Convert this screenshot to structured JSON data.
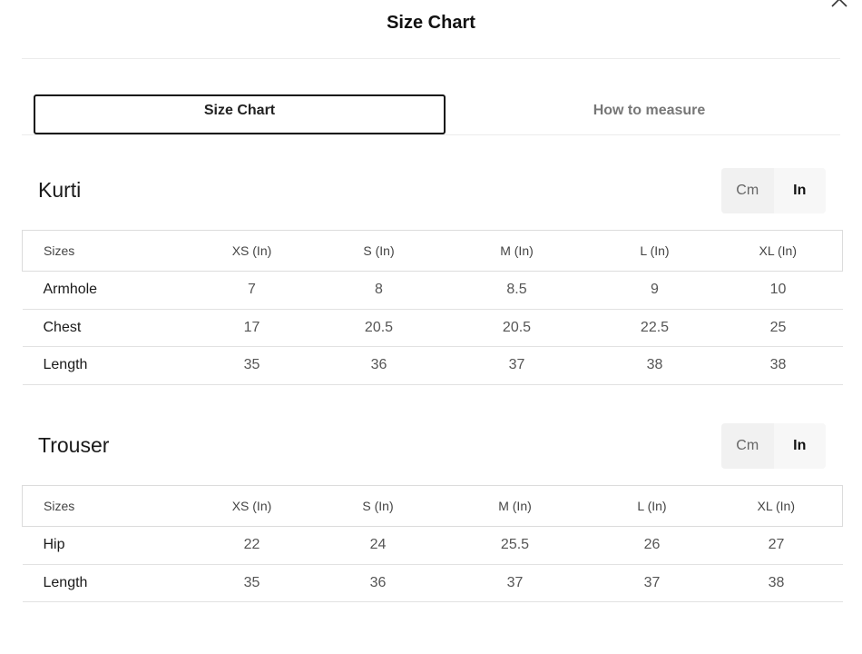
{
  "modal": {
    "title": "Size Chart",
    "close_icon": "close-icon"
  },
  "tabs": [
    {
      "label": "Size Chart",
      "active": true
    },
    {
      "label": "How to measure",
      "active": false
    }
  ],
  "units": {
    "cm_label": "Cm",
    "in_label": "In",
    "selected": "In"
  },
  "kurti": {
    "title": "Kurti",
    "headers": [
      "Sizes",
      "XS (In)",
      "S (In)",
      "M (In)",
      "L (In)",
      "XL (In)"
    ],
    "rows": [
      {
        "label": "Armhole",
        "values": [
          "7",
          "8",
          "8.5",
          "9",
          "10"
        ]
      },
      {
        "label": "Chest",
        "values": [
          "17",
          "20.5",
          "20.5",
          "22.5",
          "25"
        ]
      },
      {
        "label": "Length",
        "values": [
          "35",
          "36",
          "37",
          "38",
          "38"
        ]
      }
    ]
  },
  "trouser": {
    "title": "Trouser",
    "headers": [
      "Sizes",
      "XS (In)",
      "S (In)",
      "M (In)",
      "L (In)",
      "XL (In)"
    ],
    "rows": [
      {
        "label": "Hip",
        "values": [
          "22",
          "24",
          "25.5",
          "26",
          "27"
        ]
      },
      {
        "label": "Length",
        "values": [
          "35",
          "36",
          "37",
          "37",
          "38"
        ]
      }
    ]
  }
}
